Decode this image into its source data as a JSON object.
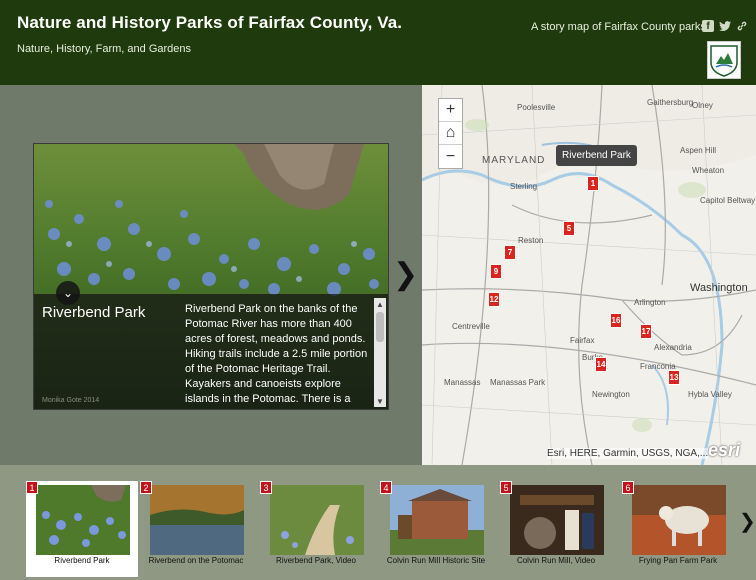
{
  "header": {
    "title": "Nature and History Parks of Fairfax County, Va.",
    "subtitle": "Nature, History, Farm, and Gardens",
    "tagline": "A story map of Fairfax County parks"
  },
  "social": {
    "facebook": "f",
    "twitter": "t",
    "link": "⚲"
  },
  "main": {
    "place_name": "Riverbend Park",
    "description": "Riverbend Park on the banks of the Potomac River has more than 400 acres of forest, meadows and ponds. Hiking trails include a 2.5 mile portion of the Potomac Heritage Trail. Kayakers and canoeists explore islands in the Potomac. There is a launch for canoes, kayaks or",
    "credit": "Monika Gote 2014",
    "toggle_icon": "⌄",
    "next_icon": "❯"
  },
  "map": {
    "zoom_in": "+",
    "home": "⌂",
    "zoom_out": "−",
    "popup": "Riverbend Park",
    "attribution": "Esri, HERE, Garmin, USGS, NGA,...",
    "esri_logo": "esri",
    "labels": [
      "Poolesville",
      "Gaithersburg",
      "Olney",
      "Aspen Hill",
      "Wheaton",
      "MARYLAND",
      "Sterling",
      "Reston",
      "Capitol Beltway",
      "Washington",
      "Arlington",
      "Centreville",
      "Fairfax",
      "Alexandria",
      "Franconia",
      "Burke",
      "Manassas",
      "Manassas Park",
      "Newington",
      "Hybla Valley"
    ],
    "markers": [
      "1",
      "5",
      "7",
      "9",
      "12",
      "16",
      "17",
      "14",
      "13"
    ]
  },
  "carousel": {
    "items": [
      {
        "num": "1",
        "label": "Riverbend Park"
      },
      {
        "num": "2",
        "label": "Riverbend on the Potomac"
      },
      {
        "num": "3",
        "label": "Riverbend Park, Video"
      },
      {
        "num": "4",
        "label": "Colvin Run Mill Historic Site"
      },
      {
        "num": "5",
        "label": "Colvin Run Mill, Video"
      },
      {
        "num": "6",
        "label": "Frying Pan Farm Park"
      }
    ],
    "next_icon": "❯"
  },
  "colors": {
    "header_bg": "#1f3a0c",
    "marker": "#d9251d",
    "panel_bg": "#6f7a6a"
  }
}
